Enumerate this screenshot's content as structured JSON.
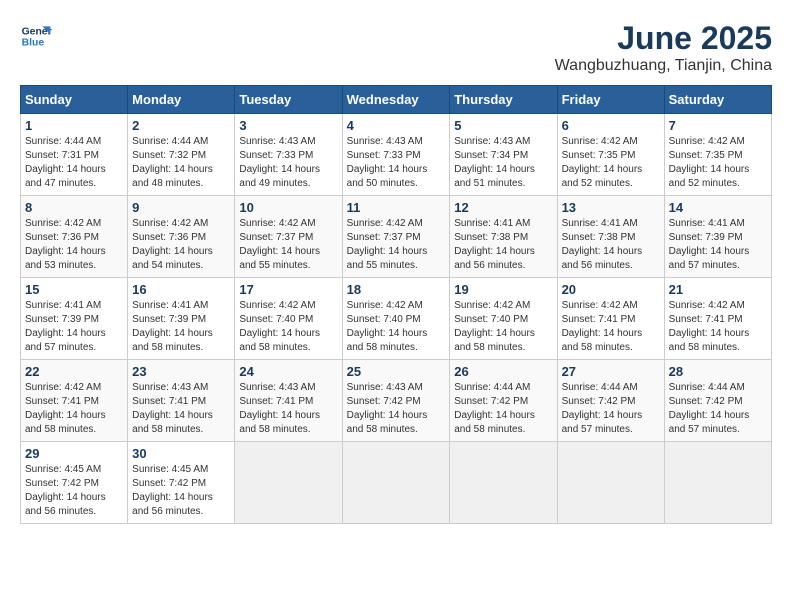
{
  "logo": {
    "line1": "General",
    "line2": "Blue"
  },
  "title": "June 2025",
  "location": "Wangbuzhuang, Tianjin, China",
  "days": [
    "Sunday",
    "Monday",
    "Tuesday",
    "Wednesday",
    "Thursday",
    "Friday",
    "Saturday"
  ],
  "weeks": [
    [
      {
        "num": "1",
        "info": "Sunrise: 4:44 AM\nSunset: 7:31 PM\nDaylight: 14 hours\nand 47 minutes."
      },
      {
        "num": "2",
        "info": "Sunrise: 4:44 AM\nSunset: 7:32 PM\nDaylight: 14 hours\nand 48 minutes."
      },
      {
        "num": "3",
        "info": "Sunrise: 4:43 AM\nSunset: 7:33 PM\nDaylight: 14 hours\nand 49 minutes."
      },
      {
        "num": "4",
        "info": "Sunrise: 4:43 AM\nSunset: 7:33 PM\nDaylight: 14 hours\nand 50 minutes."
      },
      {
        "num": "5",
        "info": "Sunrise: 4:43 AM\nSunset: 7:34 PM\nDaylight: 14 hours\nand 51 minutes."
      },
      {
        "num": "6",
        "info": "Sunrise: 4:42 AM\nSunset: 7:35 PM\nDaylight: 14 hours\nand 52 minutes."
      },
      {
        "num": "7",
        "info": "Sunrise: 4:42 AM\nSunset: 7:35 PM\nDaylight: 14 hours\nand 52 minutes."
      }
    ],
    [
      {
        "num": "8",
        "info": "Sunrise: 4:42 AM\nSunset: 7:36 PM\nDaylight: 14 hours\nand 53 minutes."
      },
      {
        "num": "9",
        "info": "Sunrise: 4:42 AM\nSunset: 7:36 PM\nDaylight: 14 hours\nand 54 minutes."
      },
      {
        "num": "10",
        "info": "Sunrise: 4:42 AM\nSunset: 7:37 PM\nDaylight: 14 hours\nand 55 minutes."
      },
      {
        "num": "11",
        "info": "Sunrise: 4:42 AM\nSunset: 7:37 PM\nDaylight: 14 hours\nand 55 minutes."
      },
      {
        "num": "12",
        "info": "Sunrise: 4:41 AM\nSunset: 7:38 PM\nDaylight: 14 hours\nand 56 minutes."
      },
      {
        "num": "13",
        "info": "Sunrise: 4:41 AM\nSunset: 7:38 PM\nDaylight: 14 hours\nand 56 minutes."
      },
      {
        "num": "14",
        "info": "Sunrise: 4:41 AM\nSunset: 7:39 PM\nDaylight: 14 hours\nand 57 minutes."
      }
    ],
    [
      {
        "num": "15",
        "info": "Sunrise: 4:41 AM\nSunset: 7:39 PM\nDaylight: 14 hours\nand 57 minutes."
      },
      {
        "num": "16",
        "info": "Sunrise: 4:41 AM\nSunset: 7:39 PM\nDaylight: 14 hours\nand 58 minutes."
      },
      {
        "num": "17",
        "info": "Sunrise: 4:42 AM\nSunset: 7:40 PM\nDaylight: 14 hours\nand 58 minutes."
      },
      {
        "num": "18",
        "info": "Sunrise: 4:42 AM\nSunset: 7:40 PM\nDaylight: 14 hours\nand 58 minutes."
      },
      {
        "num": "19",
        "info": "Sunrise: 4:42 AM\nSunset: 7:40 PM\nDaylight: 14 hours\nand 58 minutes."
      },
      {
        "num": "20",
        "info": "Sunrise: 4:42 AM\nSunset: 7:41 PM\nDaylight: 14 hours\nand 58 minutes."
      },
      {
        "num": "21",
        "info": "Sunrise: 4:42 AM\nSunset: 7:41 PM\nDaylight: 14 hours\nand 58 minutes."
      }
    ],
    [
      {
        "num": "22",
        "info": "Sunrise: 4:42 AM\nSunset: 7:41 PM\nDaylight: 14 hours\nand 58 minutes."
      },
      {
        "num": "23",
        "info": "Sunrise: 4:43 AM\nSunset: 7:41 PM\nDaylight: 14 hours\nand 58 minutes."
      },
      {
        "num": "24",
        "info": "Sunrise: 4:43 AM\nSunset: 7:41 PM\nDaylight: 14 hours\nand 58 minutes."
      },
      {
        "num": "25",
        "info": "Sunrise: 4:43 AM\nSunset: 7:42 PM\nDaylight: 14 hours\nand 58 minutes."
      },
      {
        "num": "26",
        "info": "Sunrise: 4:44 AM\nSunset: 7:42 PM\nDaylight: 14 hours\nand 58 minutes."
      },
      {
        "num": "27",
        "info": "Sunrise: 4:44 AM\nSunset: 7:42 PM\nDaylight: 14 hours\nand 57 minutes."
      },
      {
        "num": "28",
        "info": "Sunrise: 4:44 AM\nSunset: 7:42 PM\nDaylight: 14 hours\nand 57 minutes."
      }
    ],
    [
      {
        "num": "29",
        "info": "Sunrise: 4:45 AM\nSunset: 7:42 PM\nDaylight: 14 hours\nand 56 minutes."
      },
      {
        "num": "30",
        "info": "Sunrise: 4:45 AM\nSunset: 7:42 PM\nDaylight: 14 hours\nand 56 minutes."
      },
      {
        "num": "",
        "info": ""
      },
      {
        "num": "",
        "info": ""
      },
      {
        "num": "",
        "info": ""
      },
      {
        "num": "",
        "info": ""
      },
      {
        "num": "",
        "info": ""
      }
    ]
  ]
}
